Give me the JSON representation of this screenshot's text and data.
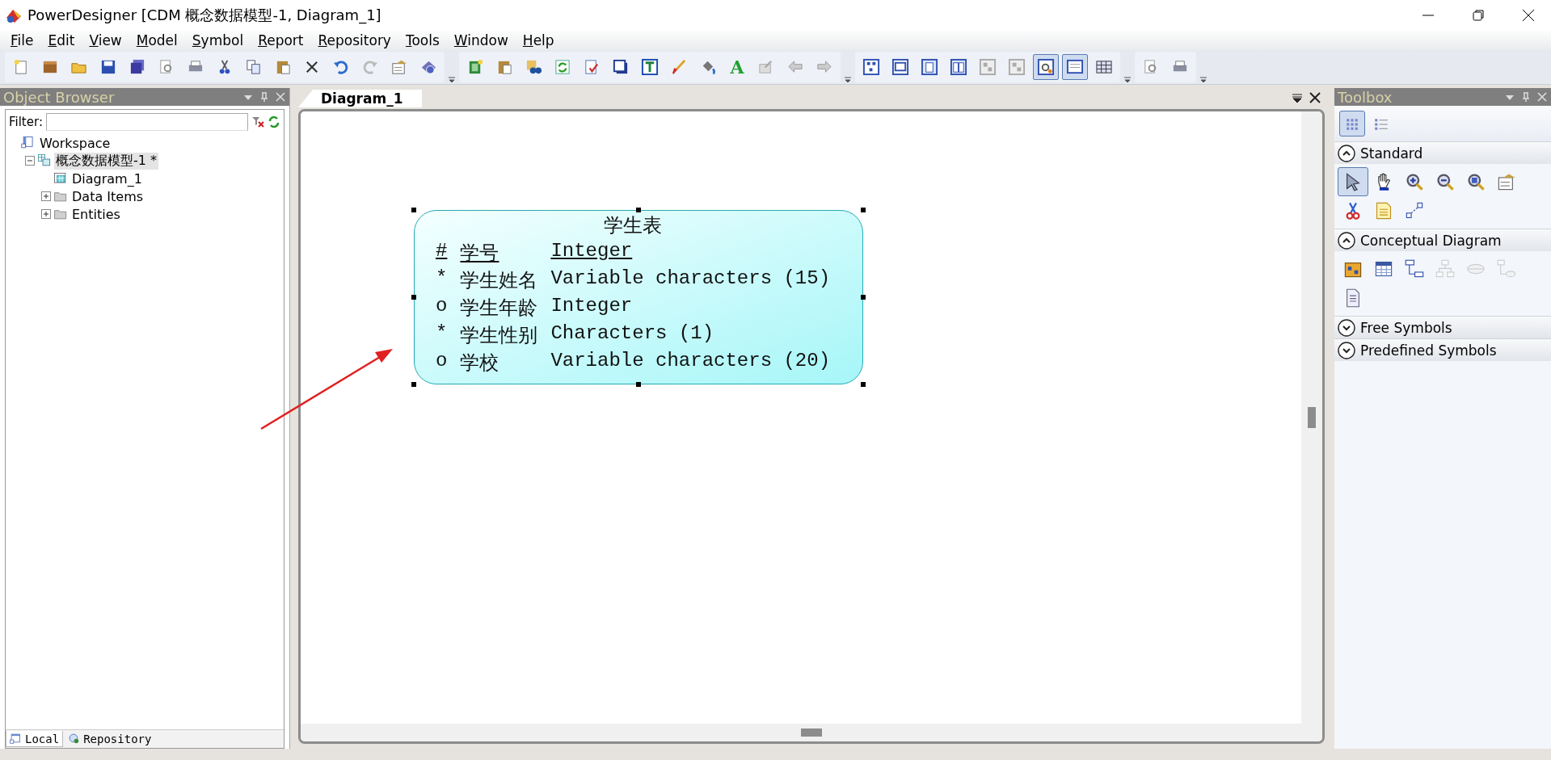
{
  "window": {
    "title": "PowerDesigner [CDM 概念数据模型-1, Diagram_1]"
  },
  "menu": [
    "File",
    "Edit",
    "View",
    "Model",
    "Symbol",
    "Report",
    "Repository",
    "Tools",
    "Window",
    "Help"
  ],
  "toolbars": [
    {
      "buttons": [
        {
          "kind": "new",
          "pressed": false
        },
        {
          "kind": "box",
          "pressed": false
        },
        {
          "kind": "folder",
          "pressed": false
        },
        {
          "kind": "save",
          "pressed": false
        },
        {
          "kind": "saveall",
          "pressed": false
        },
        {
          "kind": "preview",
          "pressed": false
        },
        {
          "kind": "print",
          "pressed": false
        },
        {
          "kind": "cut",
          "pressed": false
        },
        {
          "kind": "copy",
          "pressed": false
        },
        {
          "kind": "paste",
          "pressed": false
        },
        {
          "kind": "cross",
          "pressed": false
        },
        {
          "kind": "undo",
          "pressed": false
        },
        {
          "kind": "redo",
          "pressed": false
        },
        {
          "kind": "props",
          "pressed": false
        },
        {
          "kind": "help",
          "pressed": false
        }
      ]
    },
    {
      "buttons": [
        {
          "kind": "greendoc",
          "pressed": false
        },
        {
          "kind": "paste",
          "pressed": false
        },
        {
          "kind": "binoculars",
          "pressed": false
        },
        {
          "kind": "refresh",
          "pressed": false
        },
        {
          "kind": "checkdoc",
          "pressed": false
        },
        {
          "kind": "shadow",
          "pressed": false
        },
        {
          "kind": "textframe",
          "pressed": false
        },
        {
          "kind": "brush",
          "pressed": false
        },
        {
          "kind": "bucket",
          "pressed": false
        },
        {
          "kind": "letter",
          "glyph": "A",
          "pressed": false
        },
        {
          "kind": "export",
          "pressed": false
        },
        {
          "kind": "back",
          "pressed": false
        },
        {
          "kind": "forward",
          "pressed": false
        }
      ]
    },
    {
      "buttons": [
        {
          "kind": "tree",
          "pressed": false
        },
        {
          "kind": "tree2",
          "pressed": false
        },
        {
          "kind": "page",
          "pressed": false
        },
        {
          "kind": "pages",
          "pressed": false
        },
        {
          "kind": "greytree",
          "pressed": false
        },
        {
          "kind": "greytree",
          "pressed": false
        },
        {
          "kind": "previewbox",
          "pressed": true
        },
        {
          "kind": "comment",
          "pressed": true
        },
        {
          "kind": "grid",
          "pressed": false
        }
      ]
    },
    {
      "buttons": [
        {
          "kind": "preview",
          "pressed": false
        },
        {
          "kind": "print",
          "pressed": false
        }
      ]
    }
  ],
  "object_browser": {
    "title": "Object Browser",
    "filter_label": "Filter:",
    "tree": [
      {
        "label": "Workspace",
        "kind": "workspace",
        "children": [
          {
            "label": "概念数据模型-1 *",
            "kind": "model",
            "selected": true,
            "expanded": true,
            "children": [
              {
                "label": "Diagram_1",
                "kind": "diagram",
                "selected": false
              },
              {
                "label": "Data Items",
                "kind": "folder",
                "selected": false,
                "expanded": false
              },
              {
                "label": "Entities",
                "kind": "folder",
                "selected": false,
                "expanded": false
              }
            ]
          }
        ]
      }
    ],
    "tabs": [
      {
        "label": "Local",
        "kind": "local",
        "selected": true
      },
      {
        "label": "Repository",
        "kind": "repository",
        "selected": false
      }
    ]
  },
  "document_tabs": [
    {
      "label": "Diagram_1",
      "selected": true
    }
  ],
  "entity": {
    "title": "学生表",
    "attributes": [
      {
        "marker": "#",
        "name": "学号",
        "type": "Integer",
        "identifier": true
      },
      {
        "marker": "*",
        "name": "学生姓名",
        "type": "Variable characters (15)",
        "identifier": false
      },
      {
        "marker": "o",
        "name": "学生年龄",
        "type": "Integer",
        "identifier": false
      },
      {
        "marker": "*",
        "name": "学生性别",
        "type": "Characters (1)",
        "identifier": false
      },
      {
        "marker": "o",
        "name": "学校",
        "type": "Variable characters (20)",
        "identifier": false
      }
    ]
  },
  "toolbox": {
    "title": "Toolbox",
    "views": [
      {
        "kind": "grid",
        "selected": true
      },
      {
        "kind": "list",
        "selected": false
      }
    ],
    "sections": [
      {
        "title": "Standard",
        "expanded": true,
        "tools": [
          {
            "kind": "pointer",
            "selected": true,
            "disabled": false
          },
          {
            "kind": "hand",
            "selected": false,
            "disabled": false
          },
          {
            "kind": "zoomin",
            "selected": false,
            "disabled": false
          },
          {
            "kind": "zoomout",
            "selected": false,
            "disabled": false
          },
          {
            "kind": "zoomfit",
            "selected": false,
            "disabled": false
          },
          {
            "kind": "props",
            "selected": false,
            "disabled": false
          },
          {
            "kind": "scissors",
            "selected": false,
            "disabled": false
          },
          {
            "kind": "note",
            "selected": false,
            "disabled": false
          },
          {
            "kind": "link",
            "selected": false,
            "disabled": false
          }
        ]
      },
      {
        "title": "Conceptual Diagram",
        "expanded": true,
        "tools": [
          {
            "kind": "package",
            "selected": false,
            "disabled": false
          },
          {
            "kind": "entity",
            "selected": false,
            "disabled": false
          },
          {
            "kind": "relationship",
            "selected": false,
            "disabled": false
          },
          {
            "kind": "inheritance",
            "selected": false,
            "disabled": true
          },
          {
            "kind": "association",
            "selected": false,
            "disabled": true
          },
          {
            "kind": "assoclink",
            "selected": false,
            "disabled": true
          },
          {
            "kind": "file",
            "selected": false,
            "disabled": false
          }
        ]
      },
      {
        "title": "Free Symbols",
        "expanded": false
      },
      {
        "title": "Predefined Symbols",
        "expanded": false
      }
    ]
  }
}
